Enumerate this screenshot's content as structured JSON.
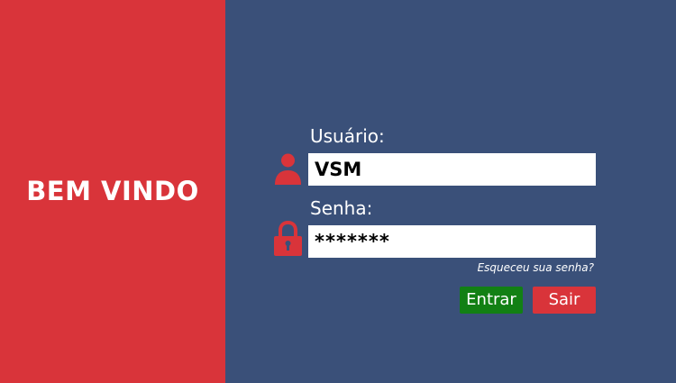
{
  "welcome": {
    "title": "BEM VINDO"
  },
  "login": {
    "user_label": "Usuário:",
    "user_value": "VSM",
    "user_icon": "user-icon",
    "password_label": "Senha:",
    "password_value": "*******",
    "password_icon": "lock-icon",
    "forgot_link": "Esqueceu sua senha?",
    "enter_label": "Entrar",
    "exit_label": "Sair"
  },
  "colors": {
    "left_panel": "#d9343a",
    "right_panel": "#3a5079",
    "icon": "#d9343a",
    "enter_button": "#128014",
    "exit_button": "#d9343a",
    "text": "#ffffff"
  }
}
